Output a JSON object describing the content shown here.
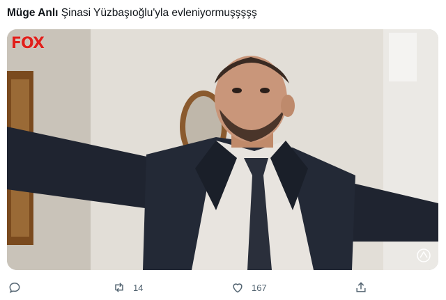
{
  "tweet": {
    "author": "Müge Anlı",
    "text": "Şinasi Yüzbaşıoğlu'yla evleniyormuşşşşş"
  },
  "media": {
    "channel_logo": "FOX",
    "subject": "man in dark suit and tie with arms spread wide"
  },
  "actions": {
    "reply": {
      "icon": "reply-icon",
      "count": ""
    },
    "retweet": {
      "icon": "retweet-icon",
      "count": "14"
    },
    "like": {
      "icon": "heart-icon",
      "count": "167"
    },
    "share": {
      "icon": "share-icon",
      "count": ""
    }
  },
  "colors": {
    "text": "#0f1419",
    "muted": "#536471",
    "logo": "#e0201b"
  }
}
